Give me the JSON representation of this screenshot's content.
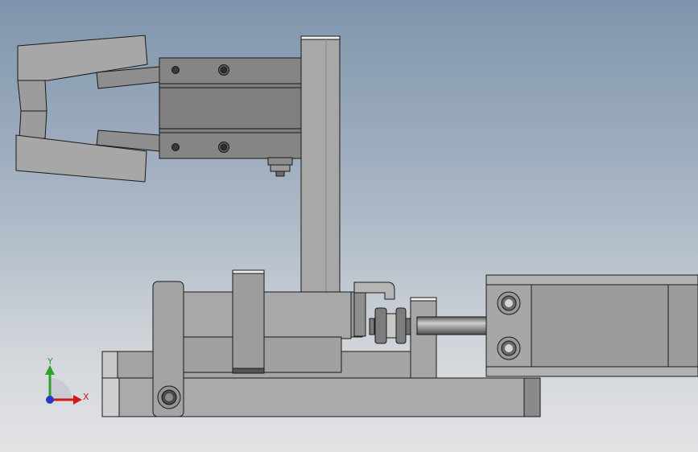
{
  "viewport": {
    "background_top": "#7f94ac",
    "background_bottom": "#e2e3e5"
  },
  "model": {
    "part_fill": "#a3a3a3",
    "part_fill_light": "#b6b6b6",
    "part_fill_dark": "#7b7b7b",
    "outline": "#1a1a1a"
  },
  "triad": {
    "x_label": "X",
    "y_label": "Y",
    "x_color": "#d11a1a",
    "y_color": "#2ea02e",
    "z_color": "#2a38c8"
  }
}
